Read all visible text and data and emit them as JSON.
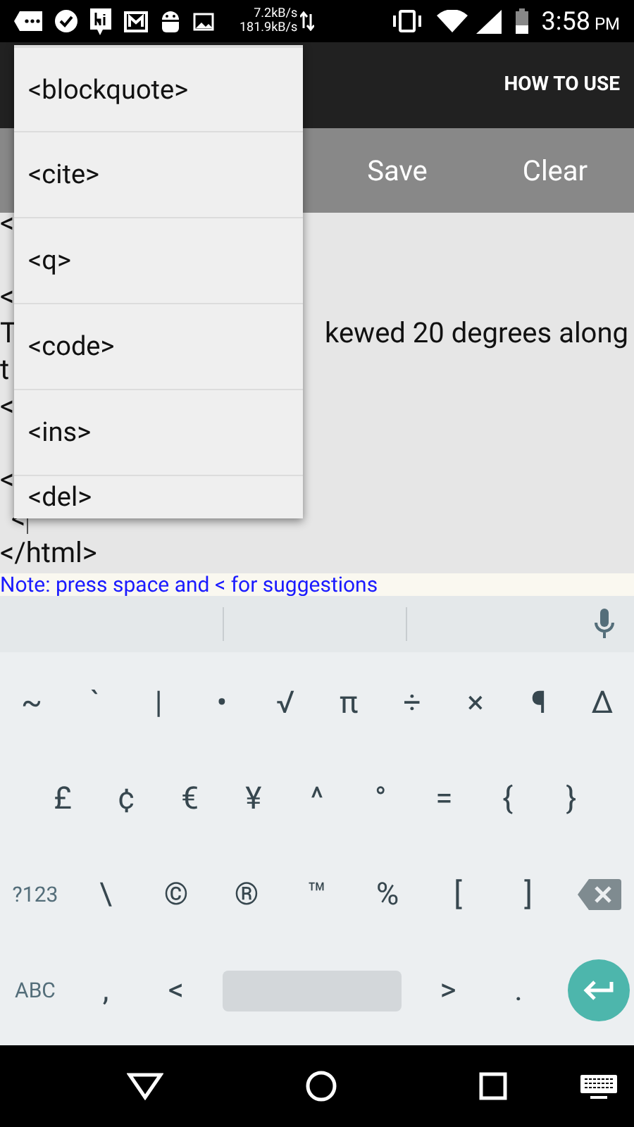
{
  "status_bar": {
    "speed_up": "7.2kB/s",
    "speed_down": "181.9kB/s",
    "time": "3:58",
    "ampm": "PM"
  },
  "app_bar": {
    "action": "HOW TO USE"
  },
  "toolbar": {
    "buttons": [
      "Save",
      "Clear"
    ]
  },
  "editor": {
    "lines": [
      {
        "kind": "text",
        "left": "<"
      },
      {
        "kind": "blank"
      },
      {
        "kind": "text",
        "left": "<"
      },
      {
        "kind": "text",
        "left": "T",
        "right": "kewed 20 degrees along"
      },
      {
        "kind": "text",
        "left": "t"
      },
      {
        "kind": "text",
        "left": "<"
      },
      {
        "kind": "blank"
      },
      {
        "kind": "text",
        "left": "<"
      },
      {
        "kind": "cursor",
        "left": "<"
      },
      {
        "kind": "text",
        "left": "</html>"
      }
    ]
  },
  "note": "Note: press space and < for suggestions",
  "suggestions": [
    "<blockquote>",
    "<cite>",
    "<q>",
    "<code>",
    "<ins>",
    "<del>"
  ],
  "keyboard": {
    "rows": [
      [
        {
          "kind": "key",
          "label": "~"
        },
        {
          "kind": "key",
          "label": "`"
        },
        {
          "kind": "key",
          "label": "|"
        },
        {
          "kind": "key",
          "label": "•"
        },
        {
          "kind": "key",
          "label": "√"
        },
        {
          "kind": "key",
          "label": "π"
        },
        {
          "kind": "key",
          "label": "÷"
        },
        {
          "kind": "key",
          "label": "×"
        },
        {
          "kind": "key",
          "label": "¶"
        },
        {
          "kind": "key",
          "label": "∆"
        }
      ],
      [
        {
          "kind": "key",
          "label": "£"
        },
        {
          "kind": "key",
          "label": "¢"
        },
        {
          "kind": "key",
          "label": "€"
        },
        {
          "kind": "key",
          "label": "¥"
        },
        {
          "kind": "key",
          "label": "^"
        },
        {
          "kind": "key",
          "label": "°"
        },
        {
          "kind": "key",
          "label": "="
        },
        {
          "kind": "key",
          "label": "{"
        },
        {
          "kind": "key",
          "label": "}"
        }
      ],
      [
        {
          "kind": "mode",
          "label": "?123"
        },
        {
          "kind": "key",
          "label": "\\"
        },
        {
          "kind": "key",
          "label": "©"
        },
        {
          "kind": "key",
          "label": "®"
        },
        {
          "kind": "key",
          "label": "™"
        },
        {
          "kind": "key",
          "label": "%"
        },
        {
          "kind": "key",
          "label": "["
        },
        {
          "kind": "key",
          "label": "]"
        },
        {
          "kind": "backspace"
        }
      ],
      [
        {
          "kind": "mode",
          "label": "ABC"
        },
        {
          "kind": "key",
          "label": ","
        },
        {
          "kind": "key",
          "label": "<"
        },
        {
          "kind": "space"
        },
        {
          "kind": "key",
          "label": ">"
        },
        {
          "kind": "key",
          "label": "."
        },
        {
          "kind": "enter"
        }
      ]
    ]
  }
}
